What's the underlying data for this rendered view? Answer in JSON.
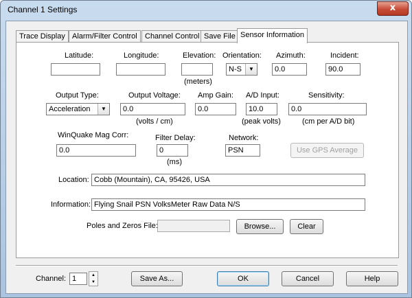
{
  "window": {
    "title": "Channel 1 Settings",
    "close_glyph": "x"
  },
  "tabs": [
    {
      "label": "Trace Display"
    },
    {
      "label": "Alarm/Filter Control"
    },
    {
      "label": "Channel Control"
    },
    {
      "label": "Save File"
    },
    {
      "label": "Sensor Information"
    }
  ],
  "active_tab": "Sensor Information",
  "sensor": {
    "latitude": {
      "label": "Latitude:",
      "value": ""
    },
    "longitude": {
      "label": "Longitude:",
      "value": ""
    },
    "elevation": {
      "label": "Elevation:",
      "value": "",
      "unit": "(meters)"
    },
    "orientation": {
      "label": "Orientation:",
      "value": "N-S"
    },
    "azimuth": {
      "label": "Azimuth:",
      "value": "0.0"
    },
    "incident": {
      "label": "Incident:",
      "value": "90.0"
    },
    "output_type": {
      "label": "Output Type:",
      "value": "Acceleration"
    },
    "output_voltage": {
      "label": "Output Voltage:",
      "value": "0.0",
      "unit": "(volts / cm)"
    },
    "amp_gain": {
      "label": "Amp Gain:",
      "value": "0.0"
    },
    "ad_input": {
      "label": "A/D Input:",
      "value": "10.0",
      "unit": "(peak volts)"
    },
    "sensitivity": {
      "label": "Sensitivity:",
      "value": "0.0",
      "unit": "(cm per A/D bit)"
    },
    "winquake": {
      "label": "WinQuake Mag Corr:",
      "value": "0.0"
    },
    "filter_delay": {
      "label": "Filter Delay:",
      "value": "0",
      "unit": "(ms)"
    },
    "network": {
      "label": "Network:",
      "value": "PSN"
    },
    "gps_button": "Use GPS Average",
    "location": {
      "label": "Location:",
      "value": "Cobb (Mountain), CA, 95426, USA"
    },
    "information": {
      "label": "Information:",
      "value": "Flying Snail PSN  VolksMeter  Raw Data  N/S"
    },
    "poles_zeros": {
      "label": "Poles and Zeros File:",
      "value": ""
    },
    "browse_button": "Browse...",
    "clear_button": "Clear"
  },
  "footer": {
    "channel_label": "Channel:",
    "channel_value": "1",
    "save_as": "Save As...",
    "ok": "OK",
    "cancel": "Cancel",
    "help": "Help"
  }
}
